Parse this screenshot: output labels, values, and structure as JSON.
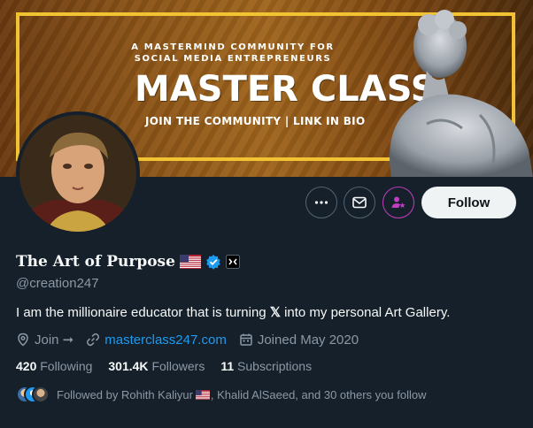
{
  "banner": {
    "line1": "A MASTERMIND COMMUNITY FOR",
    "line2": "SOCIAL MEDIA ENTREPRENEURS",
    "title": "MASTER CLASS",
    "subtitle": "JOIN THE COMMUNITY | LINK IN BIO",
    "border_color": "#f1c232"
  },
  "actions": {
    "more_icon": "more-horizontal-icon",
    "message_icon": "envelope-icon",
    "subscribe_icon": "subscribe-star-icon",
    "follow_label": "Follow"
  },
  "profile": {
    "display_name": "The Art of Purpose",
    "handle": "@creation247",
    "bio_before": "I am the millionaire educator that is turning ",
    "bio_x": "𝕏",
    "bio_after": " into my personal Art Gallery.",
    "location": "Join ➞",
    "website": "masterclass247.com",
    "joined": "Joined May 2020"
  },
  "stats": {
    "following_count": "420",
    "following_label": "Following",
    "followers_count": "301.4K",
    "followers_label": "Followers",
    "subscriptions_count": "11",
    "subscriptions_label": "Subscriptions"
  },
  "followed_by": {
    "prefix": "Followed by Rohith Kaliyur",
    "suffix": ", Khalid AlSaeed, and 30 others you follow"
  },
  "colors": {
    "background": "#15202b",
    "link": "#1d9bf0",
    "verified": "#1d9bf0",
    "subscribe_accent": "#c13ec1"
  }
}
